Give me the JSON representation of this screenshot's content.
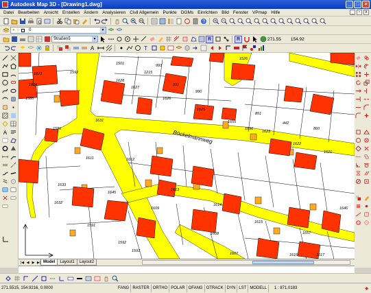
{
  "window": {
    "title": "Autodesk Map 3D - [Drawing1.dwg]",
    "minimize": "_",
    "maximize": "□",
    "close": "×"
  },
  "menu": {
    "items": [
      "Datei",
      "Bearbeiten",
      "Ansicht",
      "Erstellen",
      "Ändern",
      "Analysieren",
      "Civil Allgemein",
      "Punkte",
      "DGMs",
      "Einrichten",
      "Bild",
      "Fenster",
      "VPmap",
      "Hilfe"
    ]
  },
  "toolbar2": {
    "layer_value": "0"
  },
  "toolbar3": {
    "style_value": "Straßen5",
    "coord_x": "271.55",
    "coord_y": "154.92"
  },
  "layout_tabs": [
    "Model",
    "Layout1",
    "Layout2"
  ],
  "status": {
    "coords": "271.5515, 154.9216, 0.0000",
    "modes": [
      "FANG",
      "RASTER",
      "ORTHO",
      "POLAR",
      "OFANG",
      "OTRACK",
      "DYN",
      "LST",
      "MODELL"
    ],
    "scale": "1 : 871.0183"
  },
  "map": {
    "street_name": "Böckelmannweg",
    "parcel_labels": [
      "1823",
      "1592",
      "1501",
      "993",
      "1526",
      "1824",
      "1628",
      "1215",
      "1627",
      "991",
      "990",
      "1626",
      "1625",
      "851",
      "1585",
      "1631",
      "1655",
      "1656",
      "1623",
      "442",
      "860",
      "1586",
      "1622",
      "1621",
      "1611",
      "1612",
      "1613",
      "1633",
      "1645",
      "1609",
      "1614",
      "1615",
      "1632",
      "1646",
      "1591",
      "1608",
      "1657",
      "1592",
      "1593",
      "1607",
      "1617",
      "1616"
    ],
    "colors": {
      "street": "#ffff00",
      "building": "#ff3300",
      "annex": "#ffaa22",
      "parcel_line": "#000000",
      "background": "#ffffff"
    }
  },
  "icons": {
    "top_row": [
      "new-icon",
      "open-icon",
      "save-icon",
      "print-icon",
      "cut-icon",
      "copy-icon",
      "paste-icon",
      "undo-icon",
      "redo-icon",
      "pan-icon",
      "zoom-realtime-icon",
      "zoom-window-icon",
      "zoom-previous-icon",
      "properties-icon",
      "designcenter-icon",
      "toolpalette-icon",
      "help-icon"
    ],
    "left_tools": [
      "line-icon",
      "polyline-icon",
      "rectangle-icon",
      "arc-icon",
      "circle-icon",
      "spline-icon",
      "ellipse-icon",
      "insert-block-icon",
      "point-icon",
      "hatch-icon",
      "region-icon",
      "table-icon",
      "text-icon"
    ],
    "right_tools": [
      "erase-icon",
      "copy-object-icon",
      "mirror-icon",
      "offset-icon",
      "array-icon",
      "move-icon",
      "rotate-icon",
      "scale-icon",
      "stretch-icon",
      "trim-icon",
      "extend-icon",
      "break-icon",
      "chamfer-icon",
      "fillet-icon",
      "explode-icon"
    ]
  }
}
